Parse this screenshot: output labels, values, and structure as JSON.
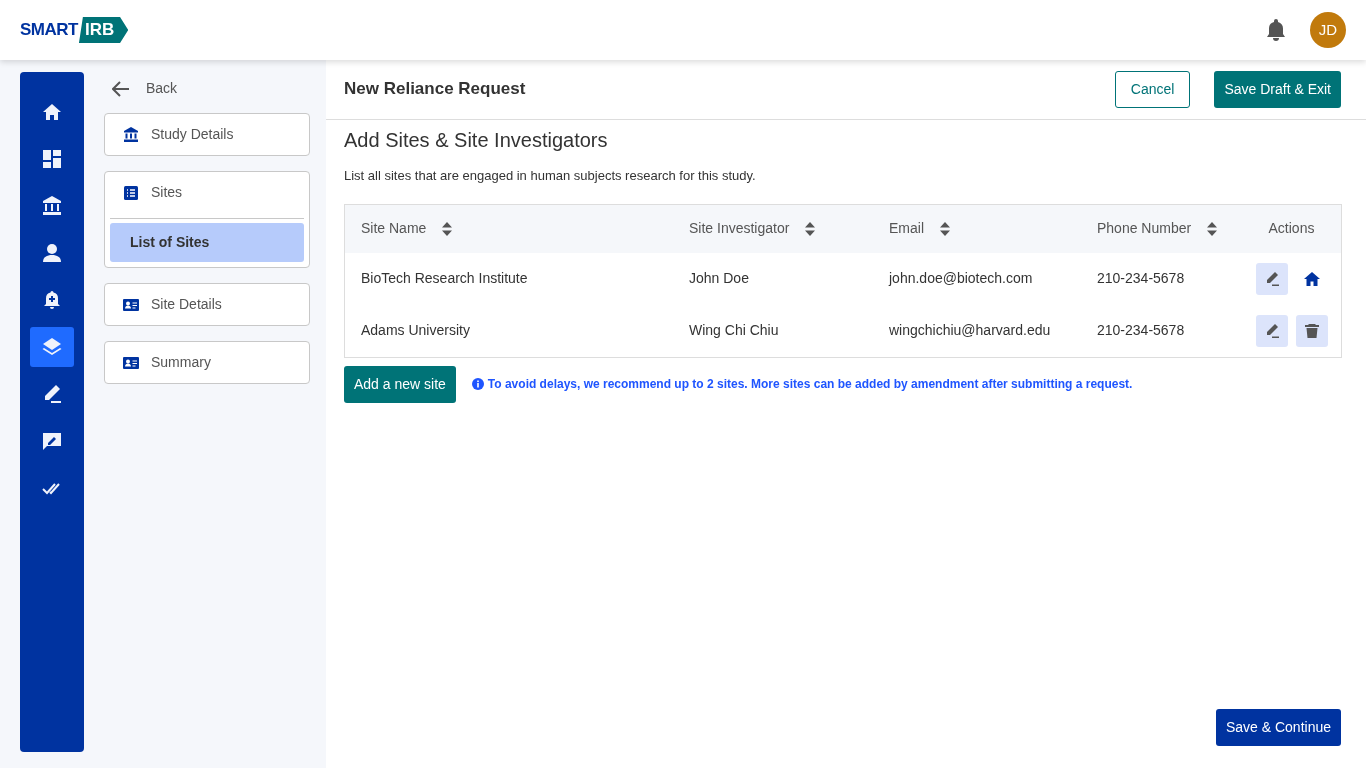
{
  "header": {
    "logo": {
      "left": "SMART",
      "right": "IRB"
    },
    "avatar": "JD"
  },
  "rail": [
    {
      "kind": "home",
      "selected": false
    },
    {
      "kind": "dashboard",
      "selected": false
    },
    {
      "kind": "institution",
      "selected": false
    },
    {
      "kind": "person",
      "selected": false
    },
    {
      "kind": "bell-plus",
      "selected": false
    },
    {
      "kind": "layers",
      "selected": true
    },
    {
      "kind": "pen",
      "selected": false
    },
    {
      "kind": "comment-pen",
      "selected": false
    },
    {
      "kind": "double-check",
      "selected": false
    }
  ],
  "back": "Back",
  "steps": [
    {
      "label": "Study Details",
      "kind": "institution"
    },
    {
      "label": "Sites",
      "kind": "list",
      "children": [
        {
          "label": "List of Sites",
          "selected": true
        }
      ]
    },
    {
      "label": "Site Details",
      "kind": "card"
    },
    {
      "label": "Summary",
      "kind": "card"
    }
  ],
  "page_title": "New Reliance Request",
  "buttons": {
    "cancel": "Cancel",
    "save_draft": "Save Draft & Exit",
    "add_site": "Add a new site",
    "save_continue": "Save & Continue"
  },
  "section_title": "Add Sites & Site Investigators",
  "description": "List all sites that are engaged in human subjects research for this study.",
  "table": {
    "columns": [
      {
        "label": "Site Name",
        "kind": "sortable"
      },
      {
        "label": "Site Investigator",
        "kind": "sortable"
      },
      {
        "label": "Email",
        "kind": "sortable"
      },
      {
        "label": "Phone Number",
        "kind": "sortable"
      },
      {
        "label": "Actions",
        "kind": "plain"
      }
    ],
    "rows": [
      {
        "cells": [
          "BioTech Research Institute",
          "John Doe",
          "john.doe@biotech.com",
          "210-234-5678"
        ],
        "actions": [
          {
            "kind": "edit"
          },
          {
            "kind": "home"
          }
        ]
      },
      {
        "cells": [
          "Adams University",
          "Wing Chi Chiu",
          "wingchichiu@harvard.edu",
          "210-234-5678"
        ],
        "actions": [
          {
            "kind": "edit"
          },
          {
            "kind": "delete"
          }
        ]
      }
    ]
  },
  "notice": "To avoid delays, we recommend up to 2 sites. More sites can be added by amendment after submitting a request."
}
